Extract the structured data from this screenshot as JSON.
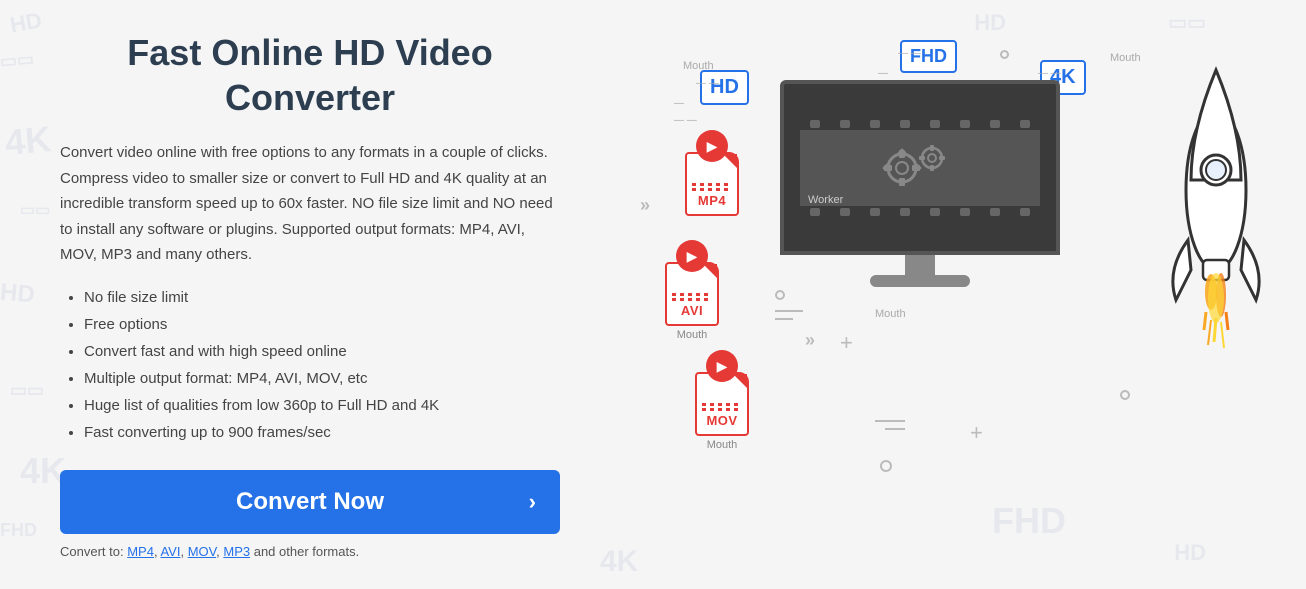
{
  "page": {
    "title": "Fast Online HD Video\nConverter",
    "description": "Convert video online with free options to any formats in a couple of clicks. Compress video to smaller size or convert to Full HD and 4K quality at an incredible transform speed up to 60x faster. NO file size limit and NO need to install any software or plugins. Supported output formats: MP4, AVI, MOV, MP3 and many others.",
    "features": [
      "No file size limit",
      "Free options",
      "Convert fast and with high speed online",
      "Multiple output format: MP4, AVI, MOV, etc",
      "Huge list of qualities from low 360p to Full HD and 4K",
      "Fast converting up to 900 frames/sec"
    ],
    "convert_button_label": "Convert Now",
    "convert_formats_prefix": "Convert to:",
    "convert_formats": [
      "MP4",
      "AVI",
      "MOV",
      "MP3"
    ],
    "convert_formats_suffix": "and other formats.",
    "worker_label": "Worker"
  },
  "illustration": {
    "formats": [
      "MP4",
      "AVI",
      "MOV"
    ],
    "quality_badges": [
      "HD",
      "FHD",
      "4K"
    ],
    "mouth_labels": [
      "Mouth",
      "Mouth",
      "Mouth",
      "Mouth"
    ]
  },
  "colors": {
    "primary": "#2471e8",
    "red": "#e53935",
    "dark_text": "#2c3e50",
    "body_text": "#444",
    "button_bg": "#2471e8",
    "button_text": "#ffffff"
  }
}
